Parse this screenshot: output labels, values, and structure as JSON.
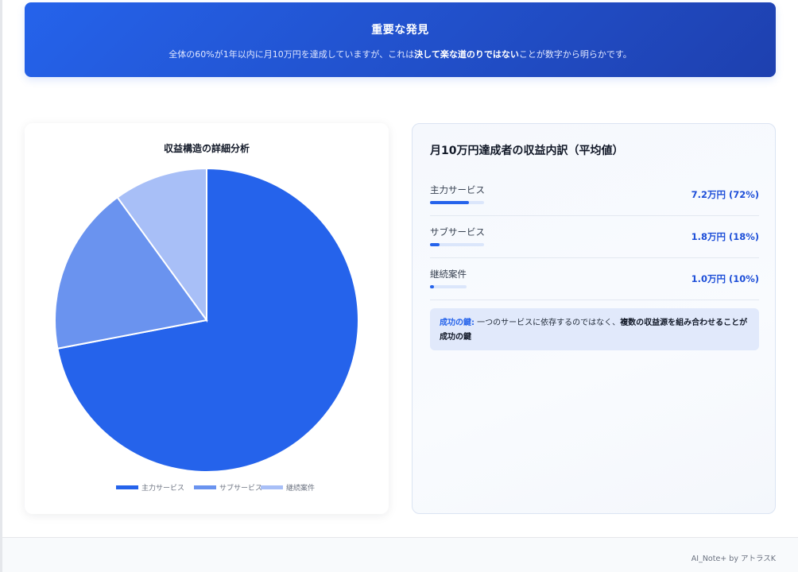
{
  "banner": {
    "title": "重要な発見",
    "text_before": "全体の60%が1年以内に月10万円を達成していますが、これは",
    "text_bold": "決して楽な道のりではない",
    "text_after": "ことが数字から明らかです。"
  },
  "chart_data": {
    "type": "pie",
    "title": "収益構造の詳細分析",
    "categories": [
      "主力サービス",
      "サブサービス",
      "継続案件"
    ],
    "values": [
      72,
      18,
      10
    ],
    "colors": [
      "#2563eb",
      "#6a93ef",
      "#a8bff7"
    ],
    "legend_position": "bottom"
  },
  "breakdown": {
    "title": "月10万円達成者の収益内訳（平均値）",
    "items": [
      {
        "label": "主力サービス",
        "value": "7.2万円 (72%)",
        "fraction": 0.72
      },
      {
        "label": "サブサービス",
        "value": "1.8万円 (18%)",
        "fraction": 0.18
      },
      {
        "label": "継続案件",
        "value": "1.0万円 (10%)",
        "fraction": 0.1
      }
    ],
    "key": {
      "label": "成功の鍵:",
      "text": " 一つのサービスに依存するのではなく、",
      "strong": "複数の収益源を組み合わせることが成功の鍵"
    }
  },
  "footer": {
    "credit": "AI_Note+ by アトラスK"
  }
}
